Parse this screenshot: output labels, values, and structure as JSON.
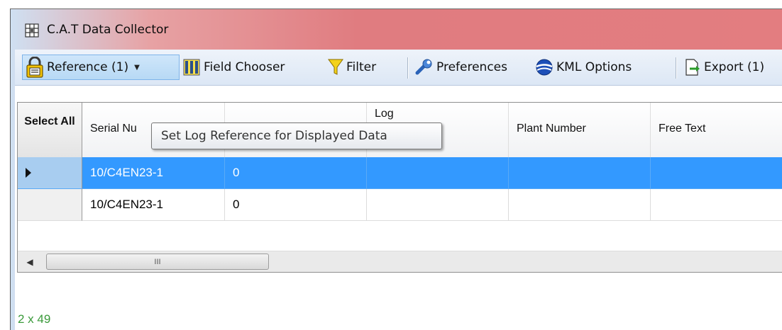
{
  "window": {
    "title": "C.A.T Data Collector"
  },
  "toolbar": {
    "reference_label": "Reference (1)",
    "field_chooser_label": "Field Chooser",
    "filter_label": "Filter",
    "preferences_label": "Preferences",
    "kml_options_label": "KML Options",
    "export_label": "Export (1)"
  },
  "grid": {
    "select_all_label": "Select All",
    "columns": [
      "Serial Nu",
      "",
      "Log",
      "Plant Number",
      "Free Text"
    ],
    "rows": [
      {
        "serial": "10/C4EN23-1",
        "col2": "0",
        "log": "",
        "plant": "",
        "free": "",
        "selected": true
      },
      {
        "serial": "10/C4EN23-1",
        "col2": "0",
        "log": "",
        "plant": "",
        "free": "",
        "selected": false
      }
    ],
    "scroll_thumb_grip": "III"
  },
  "status": {
    "text": "2 x 49"
  },
  "tooltip": {
    "text": "Set Log Reference for Displayed Data"
  },
  "colors": {
    "selection": "#3399ff",
    "status_text": "#3a9a3a",
    "toolbar_highlight": "#b7d9f5"
  },
  "icons": [
    "app-grid-icon",
    "lock-icon",
    "dropdown-arrow-icon",
    "columns-icon",
    "funnel-filter-icon",
    "wrench-icon",
    "globe-icon",
    "export-icon",
    "current-row-arrow-icon",
    "scroll-left-icon"
  ]
}
